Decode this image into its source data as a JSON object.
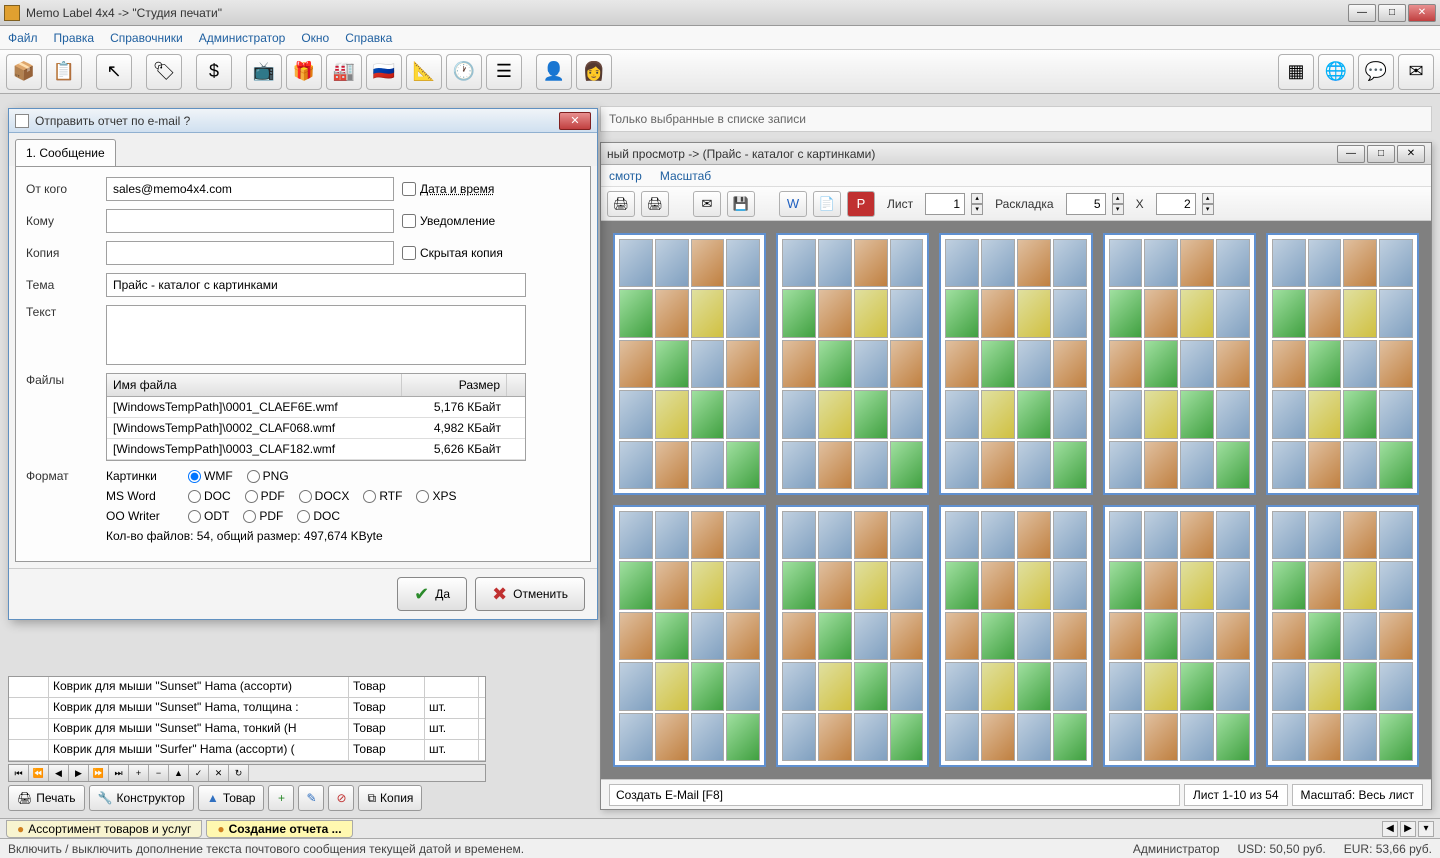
{
  "window": {
    "title": "Memo Label 4x4 -> \"Студия печати\""
  },
  "menu": {
    "file": "Файл",
    "edit": "Правка",
    "refs": "Справочники",
    "admin": "Администратор",
    "window": "Окно",
    "help": "Справка"
  },
  "filter": {
    "only_selected": "Только выбранные в списке записи"
  },
  "preview": {
    "title": "ный просмотр -> (Прайс - каталог с картинками)",
    "menu_view": "смотр",
    "menu_scale": "Масштаб",
    "list_label": "Лист",
    "list_value": "1",
    "layout_label": "Раскладка",
    "layout_cols": "5",
    "layout_x": "X",
    "layout_rows": "2",
    "status_hint": "Создать E-Mail [F8]",
    "page_info": "Лист 1-10 из 54",
    "scale_info": "Масштаб: Весь лист"
  },
  "dialog": {
    "title": "Отправить отчет по e-mail ?",
    "tab1": "1. Сообщение",
    "from_label": "От кого",
    "from_value": "sales@memo4x4.com",
    "to_label": "Кому",
    "copy_label": "Копия",
    "datetime_label": "Дата и время",
    "notify_label": "Уведомление",
    "hidden_label": "Скрытая копия",
    "subject_label": "Тема",
    "subject_value": "Прайс - каталог с картинками",
    "text_label": "Текст",
    "files_label": "Файлы",
    "col_filename": "Имя файла",
    "col_size": "Размер",
    "files": [
      {
        "name": "[WindowsTempPath]\\0001_CLAEF6E.wmf",
        "size": "5,176 КБайт"
      },
      {
        "name": "[WindowsTempPath]\\0002_CLAF068.wmf",
        "size": "4,982 КБайт"
      },
      {
        "name": "[WindowsTempPath]\\0003_CLAF182.wmf",
        "size": "5,626 КБайт"
      }
    ],
    "format_label": "Формат",
    "pictures_label": "Картинки",
    "msword_label": "MS Word",
    "oowriter_label": "OO Writer",
    "fmt_wmf": "WMF",
    "fmt_png": "PNG",
    "fmt_doc": "DOC",
    "fmt_pdf": "PDF",
    "fmt_docx": "DOCX",
    "fmt_rtf": "RTF",
    "fmt_xps": "XPS",
    "fmt_odt": "ODT",
    "summary": "Кол-во файлов: 54, общий размер: 497,674 KByte",
    "btn_yes": "Да",
    "btn_cancel": "Отменить"
  },
  "grid": {
    "rows": [
      {
        "name": "Коврик для мыши \"Sunset\" Hama (ассорти)",
        "type": "Товар",
        "unit": ""
      },
      {
        "name": "Коврик для мыши \"Sunset\" Hama, толщина :",
        "type": "Товар",
        "unit": "шт."
      },
      {
        "name": "Коврик для мыши \"Sunset\" Hama, тонкий (H",
        "type": "Товар",
        "unit": "шт."
      },
      {
        "name": "Коврик для мыши \"Surfer\" Hama (ассорти) (",
        "type": "Товар",
        "unit": "шт."
      }
    ]
  },
  "actions": {
    "print": "Печать",
    "constructor": "Конструктор",
    "product": "Товар",
    "copy": "Копия"
  },
  "tabs": {
    "assort": "Ассортимент товаров и услуг",
    "report": "Создание отчета ..."
  },
  "status": {
    "hint": "Включить / выключить дополнение текста почтового сообщения текущей датой и временем.",
    "admin": "Администратор",
    "usd": "USD: 50,50 руб.",
    "eur": "EUR: 53,66 руб."
  }
}
